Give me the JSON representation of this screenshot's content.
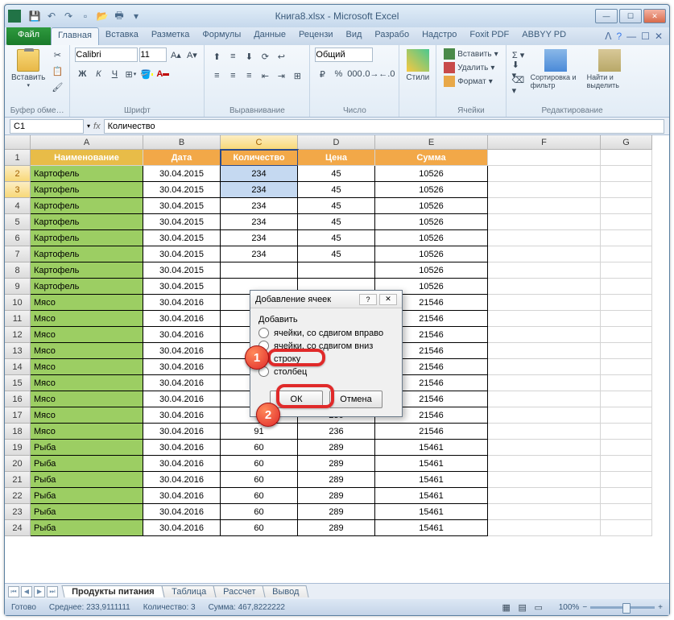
{
  "window_title": "Книга8.xlsx - Microsoft Excel",
  "file_tab": "Файл",
  "tabs": [
    "Главная",
    "Вставка",
    "Разметка",
    "Формулы",
    "Данные",
    "Рецензи",
    "Вид",
    "Разрабо",
    "Надстро",
    "Foxit PDF",
    "ABBYY PD"
  ],
  "ribbon": {
    "clipboard": {
      "paste": "Вставить",
      "title": "Буфер обме…"
    },
    "font": {
      "name": "Calibri",
      "size": "11",
      "bold": "Ж",
      "italic": "К",
      "underline": "Ч",
      "title": "Шрифт"
    },
    "align": {
      "title": "Выравнивание"
    },
    "number": {
      "format": "Общий",
      "title": "Число"
    },
    "styles": {
      "styles_btn": "Стили"
    },
    "cells": {
      "insert": "Вставить",
      "delete": "Удалить",
      "format": "Формат",
      "title": "Ячейки"
    },
    "editing": {
      "sort": "Сортировка и фильтр",
      "find": "Найти и выделить",
      "title": "Редактирование"
    }
  },
  "name_box": "C1",
  "formula_value": "Количество",
  "col_letters": [
    "A",
    "B",
    "C",
    "D",
    "E",
    "F",
    "G"
  ],
  "header_row": [
    "Наименование",
    "Дата",
    "Количество",
    "Цена",
    "Сумма"
  ],
  "rows": [
    [
      "Картофель",
      "30.04.2015",
      "234",
      "45",
      "10526"
    ],
    [
      "Картофель",
      "30.04.2015",
      "234",
      "45",
      "10526"
    ],
    [
      "Картофель",
      "30.04.2015",
      "234",
      "45",
      "10526"
    ],
    [
      "Картофель",
      "30.04.2015",
      "234",
      "45",
      "10526"
    ],
    [
      "Картофель",
      "30.04.2015",
      "234",
      "45",
      "10526"
    ],
    [
      "Картофель",
      "30.04.2015",
      "234",
      "45",
      "10526"
    ],
    [
      "Картофель",
      "30.04.2015",
      "",
      "",
      "10526"
    ],
    [
      "Картофель",
      "30.04.2015",
      "",
      "",
      "10526"
    ],
    [
      "Мясо",
      "30.04.2016",
      "",
      "",
      "21546"
    ],
    [
      "Мясо",
      "30.04.2016",
      "",
      "",
      "21546"
    ],
    [
      "Мясо",
      "30.04.2016",
      "",
      "",
      "21546"
    ],
    [
      "Мясо",
      "30.04.2016",
      "",
      "",
      "21546"
    ],
    [
      "Мясо",
      "30.04.2016",
      "",
      "",
      "21546"
    ],
    [
      "Мясо",
      "30.04.2016",
      "",
      "",
      "21546"
    ],
    [
      "Мясо",
      "30.04.2016",
      "",
      "",
      "21546"
    ],
    [
      "Мясо",
      "30.04.2016",
      "",
      "236",
      "21546"
    ],
    [
      "Мясо",
      "30.04.2016",
      "91",
      "236",
      "21546"
    ],
    [
      "Рыба",
      "30.04.2016",
      "60",
      "289",
      "15461"
    ],
    [
      "Рыба",
      "30.04.2016",
      "60",
      "289",
      "15461"
    ],
    [
      "Рыба",
      "30.04.2016",
      "60",
      "289",
      "15461"
    ],
    [
      "Рыба",
      "30.04.2016",
      "60",
      "289",
      "15461"
    ],
    [
      "Рыба",
      "30.04.2016",
      "60",
      "289",
      "15461"
    ],
    [
      "Рыба",
      "30.04.2016",
      "60",
      "289",
      "15461"
    ]
  ],
  "sheets": [
    "Продукты питания",
    "Таблица",
    "Рассчет",
    "Вывод"
  ],
  "status": {
    "ready": "Готово",
    "avg_label": "Среднее:",
    "avg_val": "233,9111111",
    "count_label": "Количество:",
    "count_val": "3",
    "sum_label": "Сумма:",
    "sum_val": "467,8222222",
    "zoom": "100%"
  },
  "dialog": {
    "title": "Добавление ячеек",
    "group": "Добавить",
    "opt1": "ячейки, со сдвигом вправо",
    "opt2": "ячейки, со сдвигом вниз",
    "opt3": "строку",
    "opt4": "столбец",
    "ok": "ОК",
    "cancel": "Отмена"
  },
  "callout1": "1",
  "callout2": "2"
}
